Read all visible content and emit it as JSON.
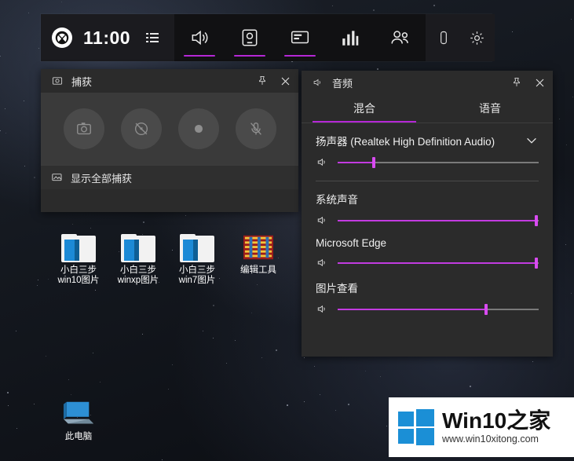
{
  "gamebar": {
    "clock": "11:00",
    "xbox_icon": "xbox-logo-icon",
    "menu_icon": "menu-list-icon",
    "items": [
      {
        "name": "audio",
        "icon": "speaker-icon",
        "underline": true
      },
      {
        "name": "capture",
        "icon": "capture-camera-icon",
        "underline": true
      },
      {
        "name": "broadcast",
        "icon": "broadcast-screen-icon",
        "underline": true
      },
      {
        "name": "performance",
        "icon": "chart-bars-icon",
        "underline": false
      },
      {
        "name": "xbox-social",
        "icon": "people-icon",
        "underline": false
      }
    ],
    "right_items": [
      {
        "name": "feedback",
        "icon": "feedback-icon"
      },
      {
        "name": "settings",
        "icon": "gear-icon"
      }
    ]
  },
  "capture_panel": {
    "title": "捕获",
    "title_icon": "capture-icon",
    "pin_icon": "pin-icon",
    "close_icon": "close-icon",
    "buttons": [
      {
        "name": "screenshot-button",
        "icon": "camera-icon"
      },
      {
        "name": "record-last-30s-button",
        "icon": "rewind-record-icon"
      },
      {
        "name": "start-recording-button",
        "icon": "record-dot-icon"
      },
      {
        "name": "mic-toggle-button",
        "icon": "microphone-muted-icon"
      }
    ],
    "footer_label": "显示全部捕获",
    "footer_icon": "gallery-icon"
  },
  "audio_panel": {
    "title": "音频",
    "title_icon": "speaker-icon",
    "pin_icon": "pin-icon",
    "close_icon": "close-icon",
    "tabs": [
      {
        "label": "混合",
        "active": true
      },
      {
        "label": "语音",
        "active": false
      }
    ],
    "device": {
      "label": "扬声器 (Realtek High Definition Audio)",
      "chevron_icon": "chevron-down-icon",
      "volume_icon": "speaker-icon",
      "volume_percent": 18
    },
    "apps": [
      {
        "label": "系统声音",
        "volume_icon": "speaker-icon",
        "volume_percent": 99
      },
      {
        "label": "Microsoft Edge",
        "volume_icon": "speaker-icon",
        "volume_percent": 99
      },
      {
        "label": "图片查看",
        "volume_icon": "speaker-icon",
        "volume_percent": 74
      }
    ]
  },
  "desktop_icons": [
    {
      "name": "folder-win10",
      "label": "小白三步\nwin10图片",
      "type": "folder"
    },
    {
      "name": "folder-winxp",
      "label": "小白三步\nwinxp图片",
      "type": "folder"
    },
    {
      "name": "folder-win7",
      "label": "小白三步\nwin7图片",
      "type": "folder"
    },
    {
      "name": "editor-tools",
      "label": "编辑工具",
      "type": "archive"
    },
    {
      "name": "this-pc",
      "label": "此电脑",
      "type": "computer"
    }
  ],
  "watermark": {
    "title": "Win10之家",
    "url": "www.win10xitong.com",
    "logo_icon": "windows-logo-icon"
  }
}
